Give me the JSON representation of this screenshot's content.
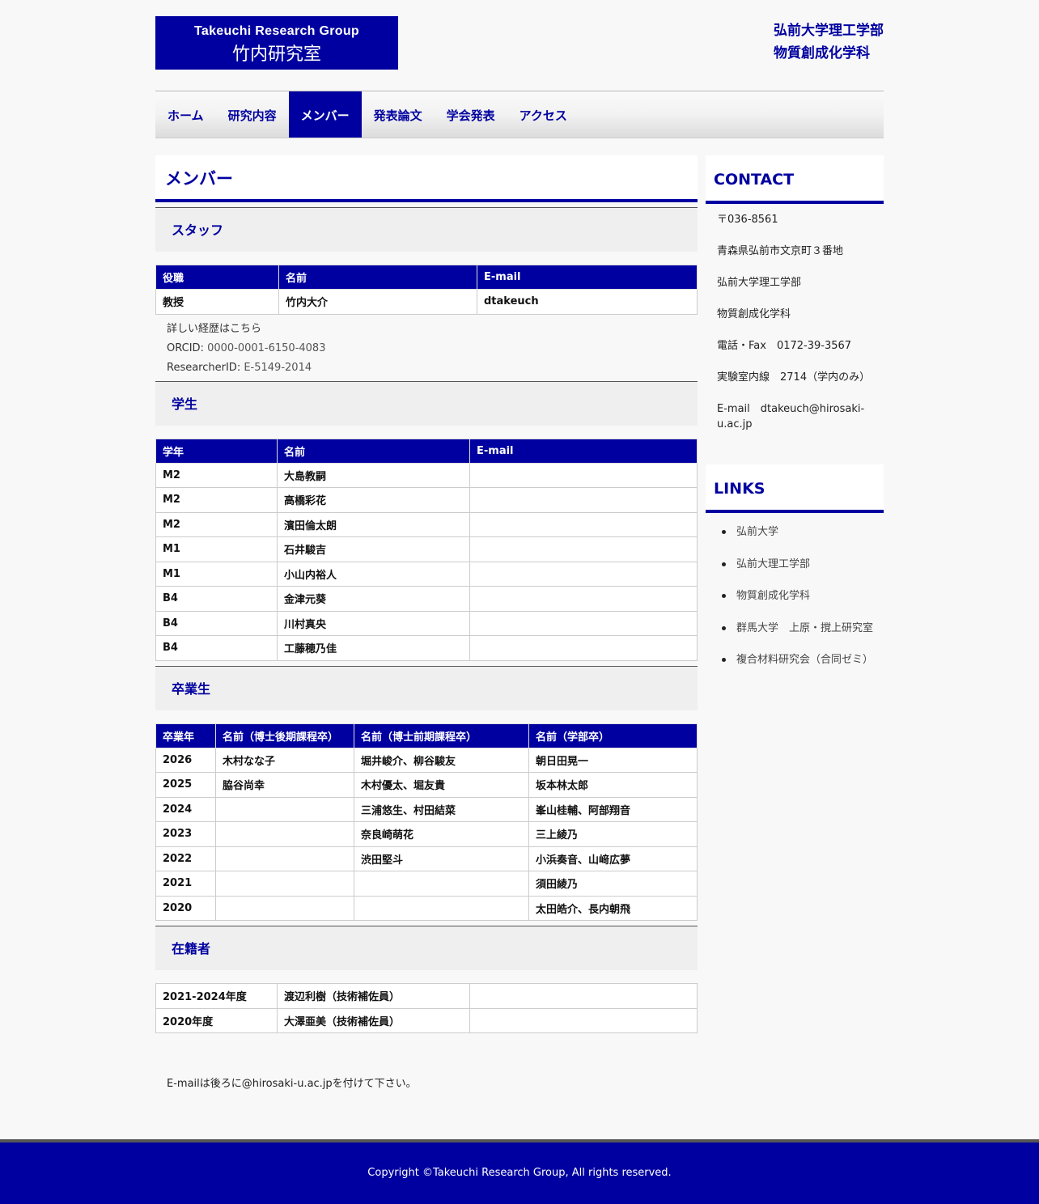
{
  "logo": {
    "en": "Takeuchi Research Group",
    "ja": "竹内研究室"
  },
  "dept": {
    "line1": "弘前大学理工学部",
    "line2": "物質創成化学科"
  },
  "nav": [
    "ホーム",
    "研究内容",
    "メンバー",
    "発表論文",
    "学会発表",
    "アクセス"
  ],
  "page_title": "メンバー",
  "staff": {
    "heading": "スタッフ",
    "headers": [
      "役職",
      "名前",
      "E-mail"
    ],
    "rows": [
      [
        "教授",
        "竹内大介",
        "dtakeuch"
      ]
    ],
    "career_link": "詳しい経歴はこちら",
    "orcid_label": "ORCID: ",
    "orcid": "0000-0001-6150-4083",
    "researcherid_label": "ResearcherID: ",
    "researcherid": "E-5149-2014"
  },
  "students": {
    "heading": "学生",
    "headers": [
      "学年",
      "名前",
      "E-mail"
    ],
    "rows": [
      [
        "M2",
        "大島教嗣",
        ""
      ],
      [
        "M2",
        "高橋彩花",
        ""
      ],
      [
        "M2",
        "濱田倫太朗",
        ""
      ],
      [
        "M1",
        "石井駿吉",
        ""
      ],
      [
        "M1",
        "小山内裕人",
        ""
      ],
      [
        "B4",
        "金津元葵",
        ""
      ],
      [
        "B4",
        "川村真央",
        ""
      ],
      [
        "B4",
        "工藤穂乃佳",
        ""
      ]
    ]
  },
  "alumni": {
    "heading": "卒業生",
    "headers": [
      "卒業年",
      "名前（博士後期課程卒）",
      "名前（博士前期課程卒）",
      "名前（学部卒）"
    ],
    "rows": [
      [
        "2026",
        "木村なな子",
        "堀井峻介、柳谷駿友",
        "朝日田晃一"
      ],
      [
        "2025",
        "脇谷尚幸",
        "木村優太、堀友貴",
        "坂本林太郎"
      ],
      [
        "2024",
        "",
        "三浦悠生、村田結菜",
        "峯山桂輔、阿部翔音"
      ],
      [
        "2023",
        "",
        "奈良崎萌花",
        "三上綾乃"
      ],
      [
        "2022",
        "",
        "渋田堅斗",
        "小浜奏音、山﨑広夢"
      ],
      [
        "2021",
        "",
        "",
        "須田綾乃"
      ],
      [
        "2020",
        "",
        "",
        "太田皓介、長内朝飛"
      ]
    ]
  },
  "former": {
    "heading": "在籍者",
    "rows": [
      [
        "2021-2024年度",
        "渡辺利樹（技術補佐員）",
        ""
      ],
      [
        "2020年度",
        "大澤亜美（技術補佐員）",
        ""
      ]
    ]
  },
  "email_note": "E-mailは後ろに@hirosaki-u.ac.jpを付けて下さい。",
  "contact": {
    "heading": "CONTACT",
    "lines": [
      "〒036-8561",
      "青森県弘前市文京町３番地",
      "弘前大学理工学部",
      "物質創成化学科",
      "電話・Fax　0172-39-3567",
      "実験室内線　2714（学内のみ）",
      "E-mail　dtakeuch@hirosaki-u.ac.jp"
    ]
  },
  "links": {
    "heading": "LINKS",
    "items": [
      "弘前大学",
      "弘前大理工学部",
      "物質創成化学科",
      "群馬大学　上原・撹上研究室",
      "複合材料研究会（合同ゼミ）"
    ]
  },
  "footer": "Copyright ©Takeuchi Research Group, All rights reserved."
}
